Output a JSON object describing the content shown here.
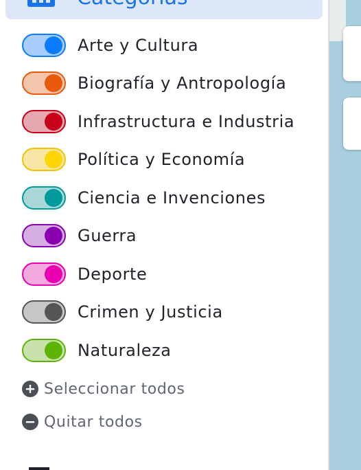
{
  "sidebar": {
    "section_title": "Categorías",
    "section_icon": "grid-icon",
    "categories": [
      {
        "label": "Arte y Cultura",
        "color": "#0a7cff",
        "track": "#a9ccff",
        "border": "#0a7cff",
        "enabled": true
      },
      {
        "label": "Biografía y Antropología",
        "color": "#e8590c",
        "track": "#f3c6ac",
        "border": "#e8590c",
        "enabled": true
      },
      {
        "label": "Infrastructura e Industria",
        "color": "#c8001a",
        "track": "#e5a8ae",
        "border": "#c8001a",
        "enabled": true
      },
      {
        "label": "Política y Economía",
        "color": "#ffd400",
        "track": "#f8e6a6",
        "border": "#f0c400",
        "enabled": true
      },
      {
        "label": "Ciencia e Invenciones",
        "color": "#009a9a",
        "track": "#a9d6d6",
        "border": "#009a9a",
        "enabled": true
      },
      {
        "label": "Guerra",
        "color": "#8a00b0",
        "track": "#d5aee2",
        "border": "#8a00b0",
        "enabled": true
      },
      {
        "label": "Deporte",
        "color": "#e800b0",
        "track": "#f1a9de",
        "border": "#e800b0",
        "enabled": true
      },
      {
        "label": "Crimen y Justicia",
        "color": "#555555",
        "track": "#c5c6c8",
        "border": "#555555",
        "enabled": true
      },
      {
        "label": "Naturaleza",
        "color": "#5cb300",
        "track": "#c9e2ad",
        "border": "#5cb300",
        "enabled": true
      }
    ],
    "select_all_label": "Seleccionar todos",
    "clear_all_label": "Quitar todos"
  }
}
